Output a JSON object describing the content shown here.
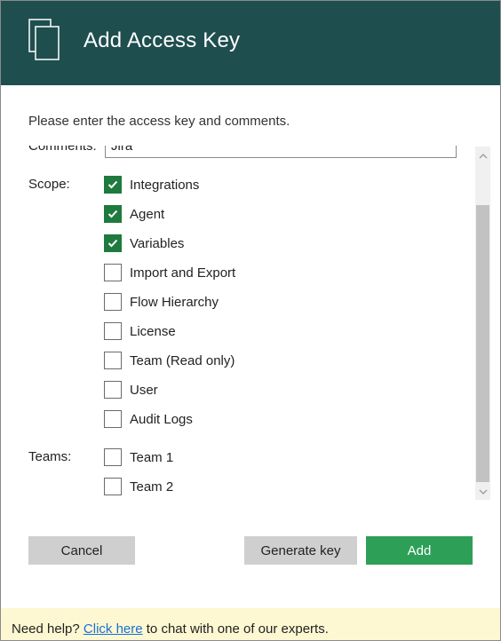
{
  "dialog": {
    "title": "Add Access Key",
    "intro": "Please enter the access key and comments."
  },
  "form": {
    "comments_label": "Comments:",
    "comments_value": "Jira",
    "scope_label": "Scope:",
    "teams_label": "Teams:",
    "scope_items": [
      {
        "label": "Integrations",
        "checked": true
      },
      {
        "label": "Agent",
        "checked": true
      },
      {
        "label": "Variables",
        "checked": true
      },
      {
        "label": "Import and Export",
        "checked": false
      },
      {
        "label": "Flow Hierarchy",
        "checked": false
      },
      {
        "label": "License",
        "checked": false
      },
      {
        "label": "Team (Read only)",
        "checked": false
      },
      {
        "label": "User",
        "checked": false
      },
      {
        "label": "Audit Logs",
        "checked": false
      }
    ],
    "team_items": [
      {
        "label": "Team 1",
        "checked": false
      },
      {
        "label": "Team 2",
        "checked": false
      }
    ]
  },
  "buttons": {
    "cancel": "Cancel",
    "generate": "Generate key",
    "add": "Add"
  },
  "footer": {
    "prefix": "Need help? ",
    "link": "Click here",
    "suffix": " to chat with one of our experts."
  },
  "colors": {
    "header": "#1f4e4f",
    "checked": "#1e7a3e",
    "primary_button": "#2e9f57",
    "footer_bg": "#fdf8d2",
    "link": "#1a6fd6"
  },
  "icons": {
    "header": "documents-icon",
    "check": "checkmark-icon",
    "scroll_up": "chevron-up-icon",
    "scroll_down": "chevron-down-icon"
  }
}
